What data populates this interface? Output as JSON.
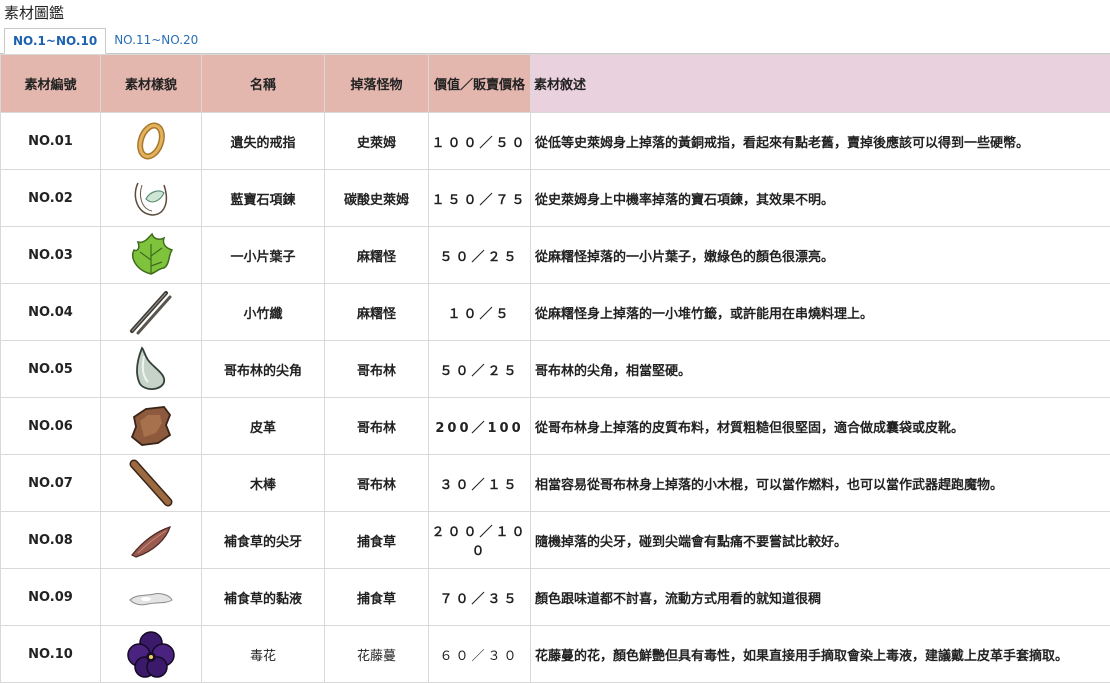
{
  "page_title": "素材圖鑑",
  "tabs": [
    {
      "label": "NO.1~NO.10",
      "active": true
    },
    {
      "label": "NO.11~NO.20",
      "active": false
    }
  ],
  "columns": [
    "素材編號",
    "素材樣貌",
    "名稱",
    "掉落怪物",
    "價值／販賣價格",
    "素材敘述"
  ],
  "rows": [
    {
      "id": "NO.01",
      "icon": "ring-icon",
      "name": "遺失的戒指",
      "monster": "史萊姆",
      "price": "１００／５０",
      "desc": "從低等史萊姆身上掉落的黃銅戒指，看起來有點老舊，賣掉後應該可以得到一些硬幣。"
    },
    {
      "id": "NO.02",
      "icon": "gem-necklace-icon",
      "name": "藍寶石項鍊",
      "monster": "碳酸史萊姆",
      "price": "１５０／７５",
      "desc": "從史萊姆身上中機率掉落的寶石項鍊，其效果不明。"
    },
    {
      "id": "NO.03",
      "icon": "leaf-icon",
      "name": "一小片葉子",
      "monster": "麻糬怪",
      "price": "５０／２５",
      "desc": "從麻糬怪掉落的一小片葉子，嫩綠色的顏色很漂亮。"
    },
    {
      "id": "NO.04",
      "icon": "bamboo-skewer-icon",
      "name": "小竹纖",
      "monster": "麻糬怪",
      "price": "１０／５",
      "desc": "從麻糬怪身上掉落的一小堆竹籤，或許能用在串燒料理上。"
    },
    {
      "id": "NO.05",
      "icon": "goblin-horn-icon",
      "name": "哥布林的尖角",
      "monster": "哥布林",
      "price": "５０／２５",
      "desc": "哥布林的尖角，相當堅硬。"
    },
    {
      "id": "NO.06",
      "icon": "leather-icon",
      "name": "皮革",
      "monster": "哥布林",
      "price": "200／100",
      "desc": "從哥布林身上掉落的皮質布料，材質粗糙但很堅固，適合做成囊袋或皮靴。"
    },
    {
      "id": "NO.07",
      "icon": "wooden-stick-icon",
      "name": "木棒",
      "monster": "哥布林",
      "price": "３０／１５",
      "desc": "相當容易從哥布林身上掉落的小木棍，可以當作燃料，也可以當作武器趕跑魔物。"
    },
    {
      "id": "NO.08",
      "icon": "fang-icon",
      "name": "補食草的尖牙",
      "monster": "捕食草",
      "price": "２００／１００",
      "desc": "隨機掉落的尖牙，碰到尖端會有點痛不要嘗試比較好。"
    },
    {
      "id": "NO.09",
      "icon": "slime-liquid-icon",
      "name": "補食草的黏液",
      "monster": "捕食草",
      "price": "７０／３５",
      "desc": "顏色跟味道都不討喜，流動方式用看的就知道很稠"
    },
    {
      "id": "NO.10",
      "icon": "poison-flower-icon",
      "name": "毒花",
      "monster": "花藤蔓",
      "price": "６０／３０",
      "desc": "花藤蔓的花，顏色鮮艷但具有毒性，如果直接用手摘取會染上毒液，建議戴上皮革手套摘取。",
      "plain": true
    }
  ]
}
